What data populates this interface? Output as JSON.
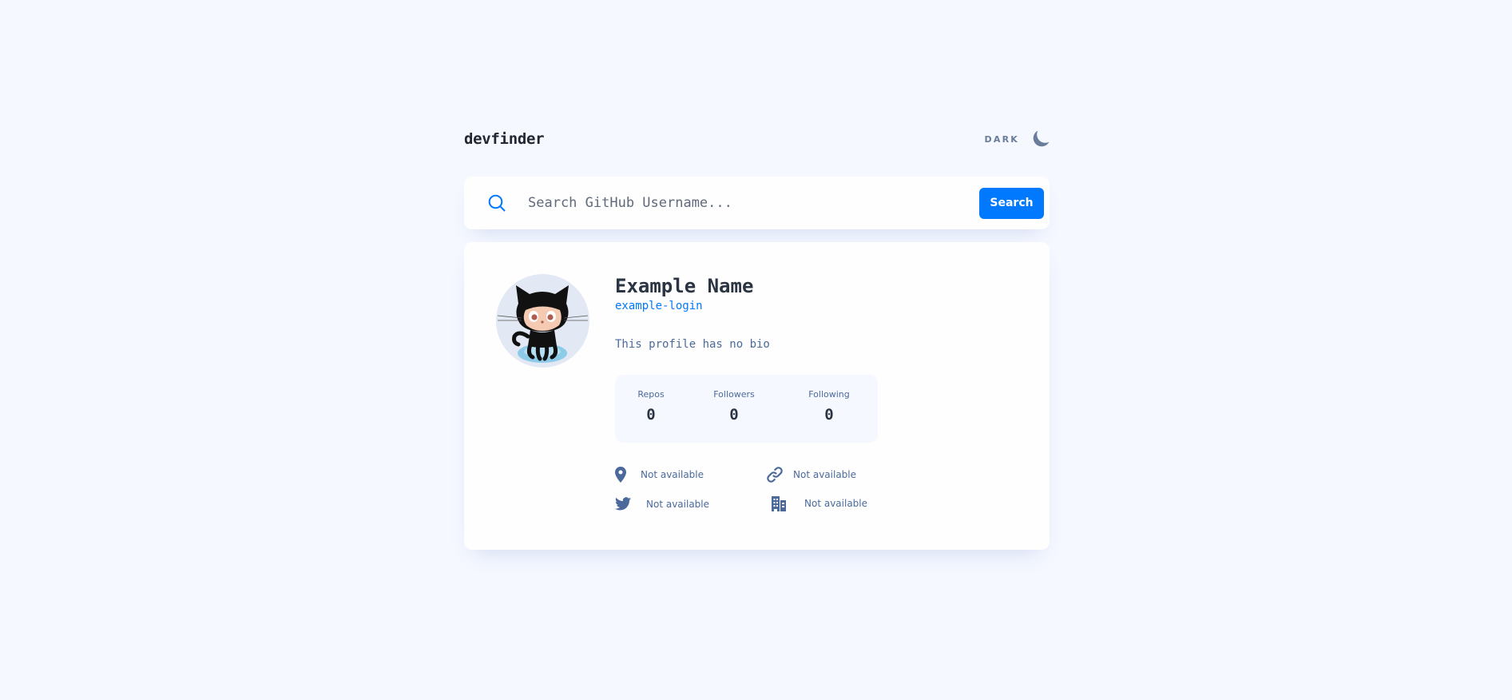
{
  "header": {
    "logo": "devfinder",
    "theme_label": "DARK",
    "theme_icon": "moon-icon"
  },
  "search": {
    "placeholder": "Search GitHub Username...",
    "value": "",
    "button_label": "Search",
    "icon": "search-icon"
  },
  "profile": {
    "name": "Example Name",
    "login": "example-login",
    "bio": "This profile has no bio",
    "avatar": "octocat-avatar",
    "stats": [
      {
        "label": "Repos",
        "value": "0"
      },
      {
        "label": "Followers",
        "value": "0"
      },
      {
        "label": "Following",
        "value": "0"
      }
    ],
    "links": {
      "location": "Not available",
      "blog": "Not available",
      "twitter": "Not available",
      "company": "Not available"
    }
  },
  "colors": {
    "accent": "#0079ff",
    "background": "#f5f8ff",
    "card": "#fefefe",
    "text_primary": "#2b3442",
    "text_secondary": "#4b6a9b"
  }
}
